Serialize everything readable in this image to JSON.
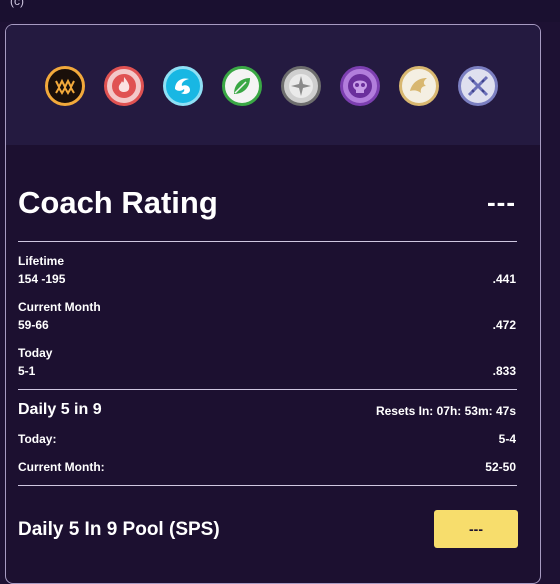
{
  "top_glyph": "(c)",
  "icons": [
    {
      "name": "monster-mouth-icon",
      "bg": "#1a0f0a",
      "ring": "#f2a93b"
    },
    {
      "name": "fire-icon",
      "bg": "#f3c9c9",
      "ring": "#e05252"
    },
    {
      "name": "water-icon",
      "bg": "#18b7e3",
      "ring": "#8fe0f5"
    },
    {
      "name": "leaf-icon",
      "bg": "#f4f4f4",
      "ring": "#3aa845"
    },
    {
      "name": "star-compass-icon",
      "bg": "#cfcfcf",
      "ring": "#6e6e6e"
    },
    {
      "name": "skull-icon",
      "bg": "#b27ddc",
      "ring": "#7c3fb0"
    },
    {
      "name": "dragon-icon",
      "bg": "#f4efe2",
      "ring": "#d8b770"
    },
    {
      "name": "crossed-swords-icon",
      "bg": "#dfe0ef",
      "ring": "#7b7fc1"
    }
  ],
  "coach": {
    "title": "Coach Rating",
    "rating": "---",
    "lifetime": {
      "label": "Lifetime",
      "record": "154 -195",
      "pct": ".441"
    },
    "month": {
      "label": "Current Month",
      "record": "59-66",
      "pct": ".472"
    },
    "today": {
      "label": "Today",
      "record": "5-1",
      "pct": ".833"
    }
  },
  "daily": {
    "title": "Daily 5 in 9",
    "resets": "Resets In: 07h: 53m: 47s",
    "today_label": "Today:",
    "today_value": "5-4",
    "month_label": "Current Month:",
    "month_value": "52-50"
  },
  "pool": {
    "title": "Daily 5 In 9 Pool (SPS)",
    "value": "---"
  }
}
